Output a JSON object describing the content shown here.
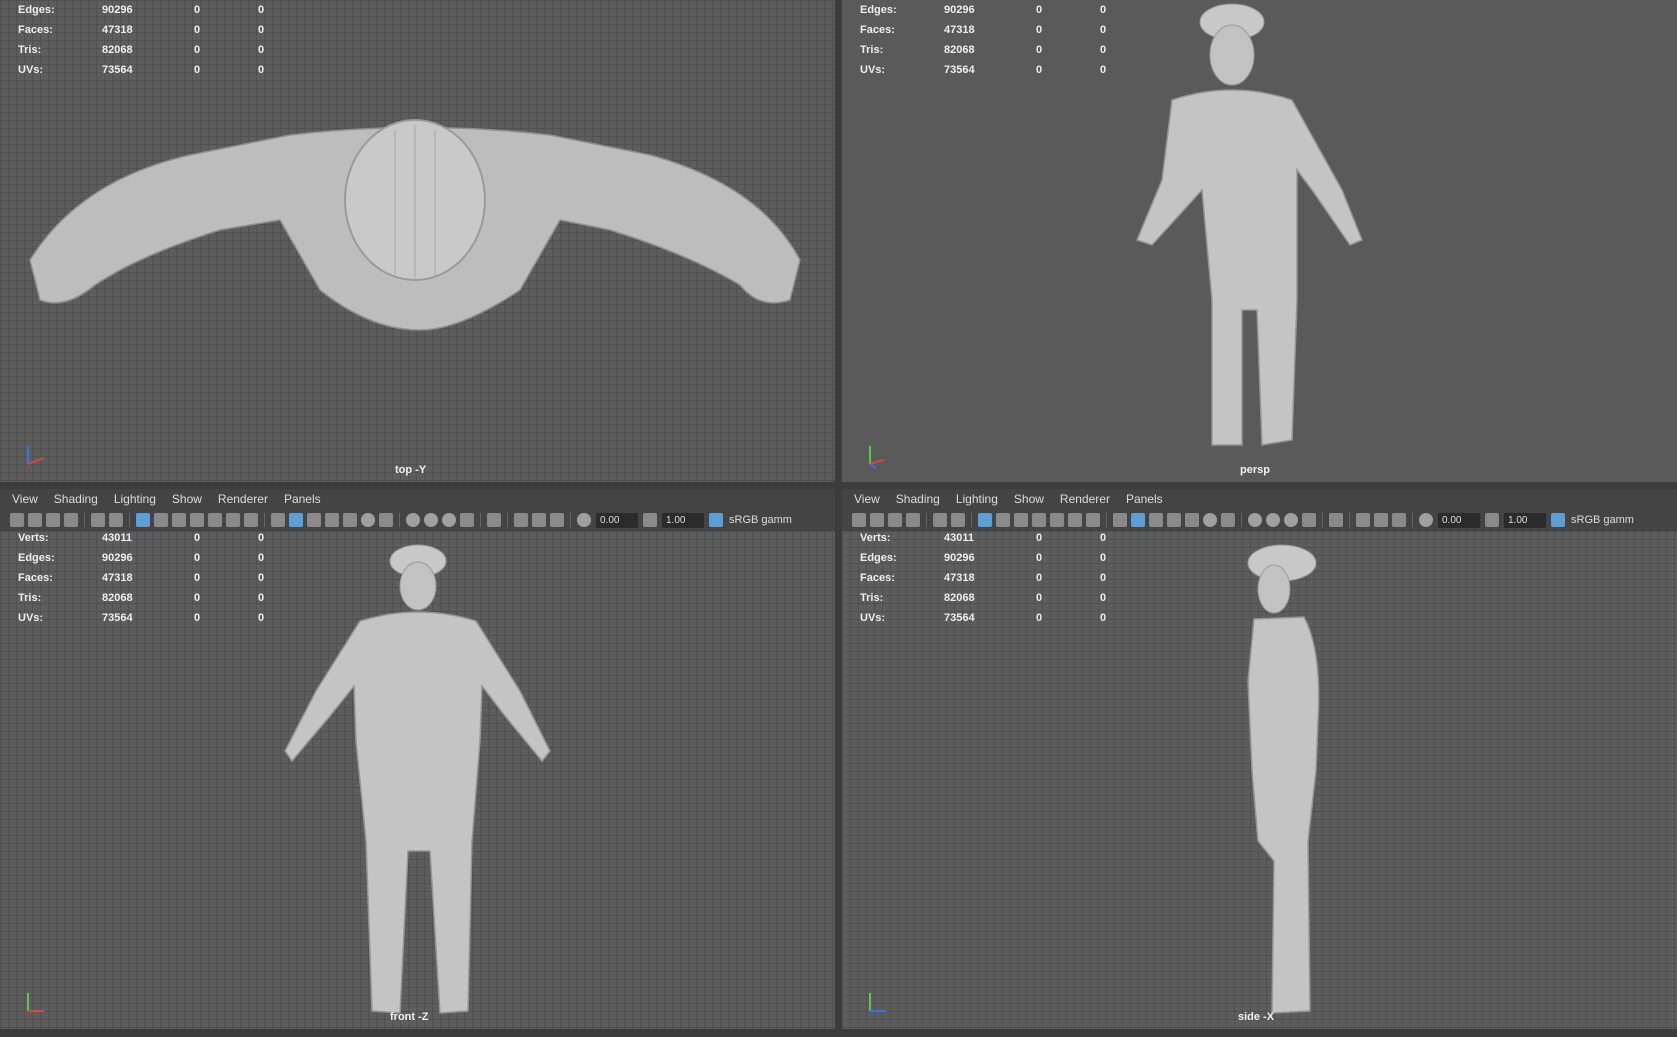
{
  "stats": {
    "labels": [
      "Verts:",
      "Edges:",
      "Faces:",
      "Tris:",
      "UVs:"
    ],
    "verts": [
      "43011",
      "0",
      "0"
    ],
    "edges": [
      "90296",
      "0",
      "0"
    ],
    "faces": [
      "47318",
      "0",
      "0"
    ],
    "tris": [
      "82068",
      "0",
      "0"
    ],
    "uvs": [
      "73564",
      "0",
      "0"
    ]
  },
  "menu": {
    "view": "View",
    "shading": "Shading",
    "lighting": "Lighting",
    "show": "Show",
    "renderer": "Renderer",
    "panels": "Panels"
  },
  "toolbar": {
    "exposure": "0.00",
    "gamma": "1.00",
    "colorspace": "sRGB gamm"
  },
  "cameras": {
    "top": "top -Y",
    "persp": "persp",
    "front": "front -Z",
    "side": "side -X"
  },
  "icons": [
    "camera-icon",
    "bookmark-icon",
    "grid-icon",
    "wireframe-icon",
    "smooth-shade-icon",
    "light-icon",
    "isolate-icon",
    "exposure-icon",
    "gamma-icon",
    "colorspace-icon"
  ],
  "colors": {
    "viewport_bg": "#5d5d5d",
    "grid_line": "#505050",
    "active_icon": "#5b9fd6",
    "axis_x": "#e0443e",
    "axis_y": "#5ac94a",
    "axis_z": "#3f6fe0"
  }
}
